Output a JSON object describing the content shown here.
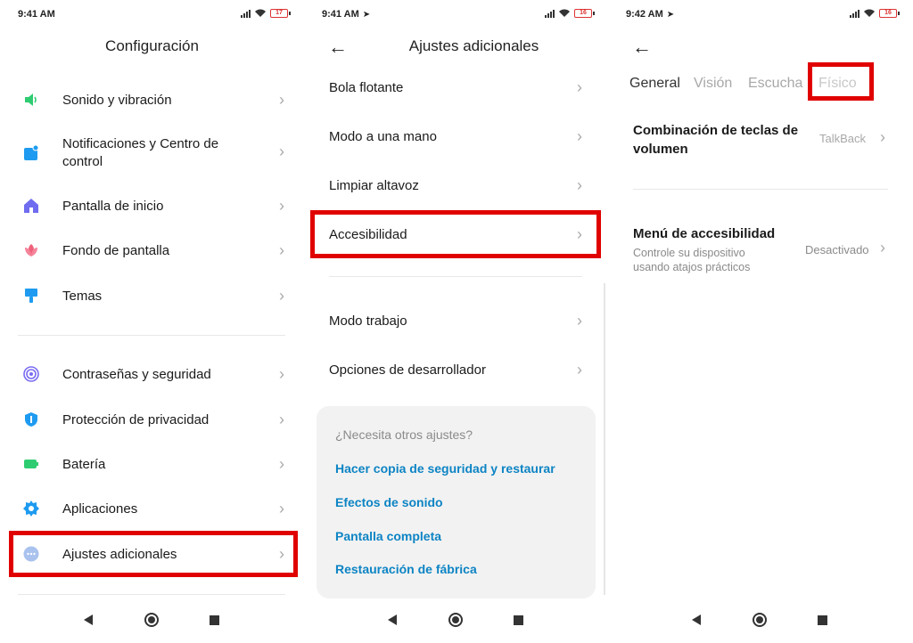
{
  "screen1": {
    "time": "9:41 AM",
    "battery": "17",
    "title": "Configuración",
    "items": [
      {
        "label": "Sonido y vibración",
        "icon": "speaker-icon",
        "color": "#2ecc71"
      },
      {
        "label": "Notificaciones y Centro de control",
        "icon": "notification-icon",
        "color": "#1e9bf0"
      },
      {
        "label": "Pantalla de inicio",
        "icon": "home-icon",
        "color": "#6f6cf0"
      },
      {
        "label": "Fondo de pantalla",
        "icon": "flower-icon",
        "color": "#f0607a"
      },
      {
        "label": "Temas",
        "icon": "paintbrush-icon",
        "color": "#1e9bf0"
      },
      {
        "label": "Contraseñas y seguridad",
        "icon": "fingerprint-icon",
        "color": "#7a6cf0"
      },
      {
        "label": "Protección de privacidad",
        "icon": "shield-icon",
        "color": "#1e9bf0"
      },
      {
        "label": "Batería",
        "icon": "battery-icon",
        "color": "#2ecc71"
      },
      {
        "label": "Aplicaciones",
        "icon": "gear-icon",
        "color": "#1e9bf0"
      },
      {
        "label": "Ajustes adicionales",
        "icon": "more-icon",
        "color": "#8fb0e8"
      }
    ]
  },
  "screen2": {
    "time": "9:41 AM",
    "battery": "16",
    "title": "Ajustes adicionales",
    "items": [
      {
        "label": "Bola flotante"
      },
      {
        "label": "Modo a una mano"
      },
      {
        "label": "Limpiar altavoz"
      },
      {
        "label": "Accesibilidad"
      },
      {
        "label": "Modo trabajo"
      },
      {
        "label": "Opciones de desarrollador"
      }
    ],
    "help": {
      "question": "¿Necesita otros ajustes?",
      "links": [
        "Hacer copia de seguridad y restaurar",
        "Efectos de sonido",
        "Pantalla completa",
        "Restauración de fábrica"
      ]
    }
  },
  "screen3": {
    "time": "9:42 AM",
    "battery": "16",
    "tabs": [
      "General",
      "Visión",
      "Escucha",
      "Físico"
    ],
    "items": [
      {
        "title": "Combinación de teclas de volumen",
        "value": "TalkBack"
      },
      {
        "title": "Menú de accesibilidad",
        "subtitle": "Controle su dispositivo usando atajos prácticos",
        "value": "Desactivado"
      }
    ]
  },
  "colors": {
    "highlight": "#e00000",
    "link": "#0d84c4"
  }
}
